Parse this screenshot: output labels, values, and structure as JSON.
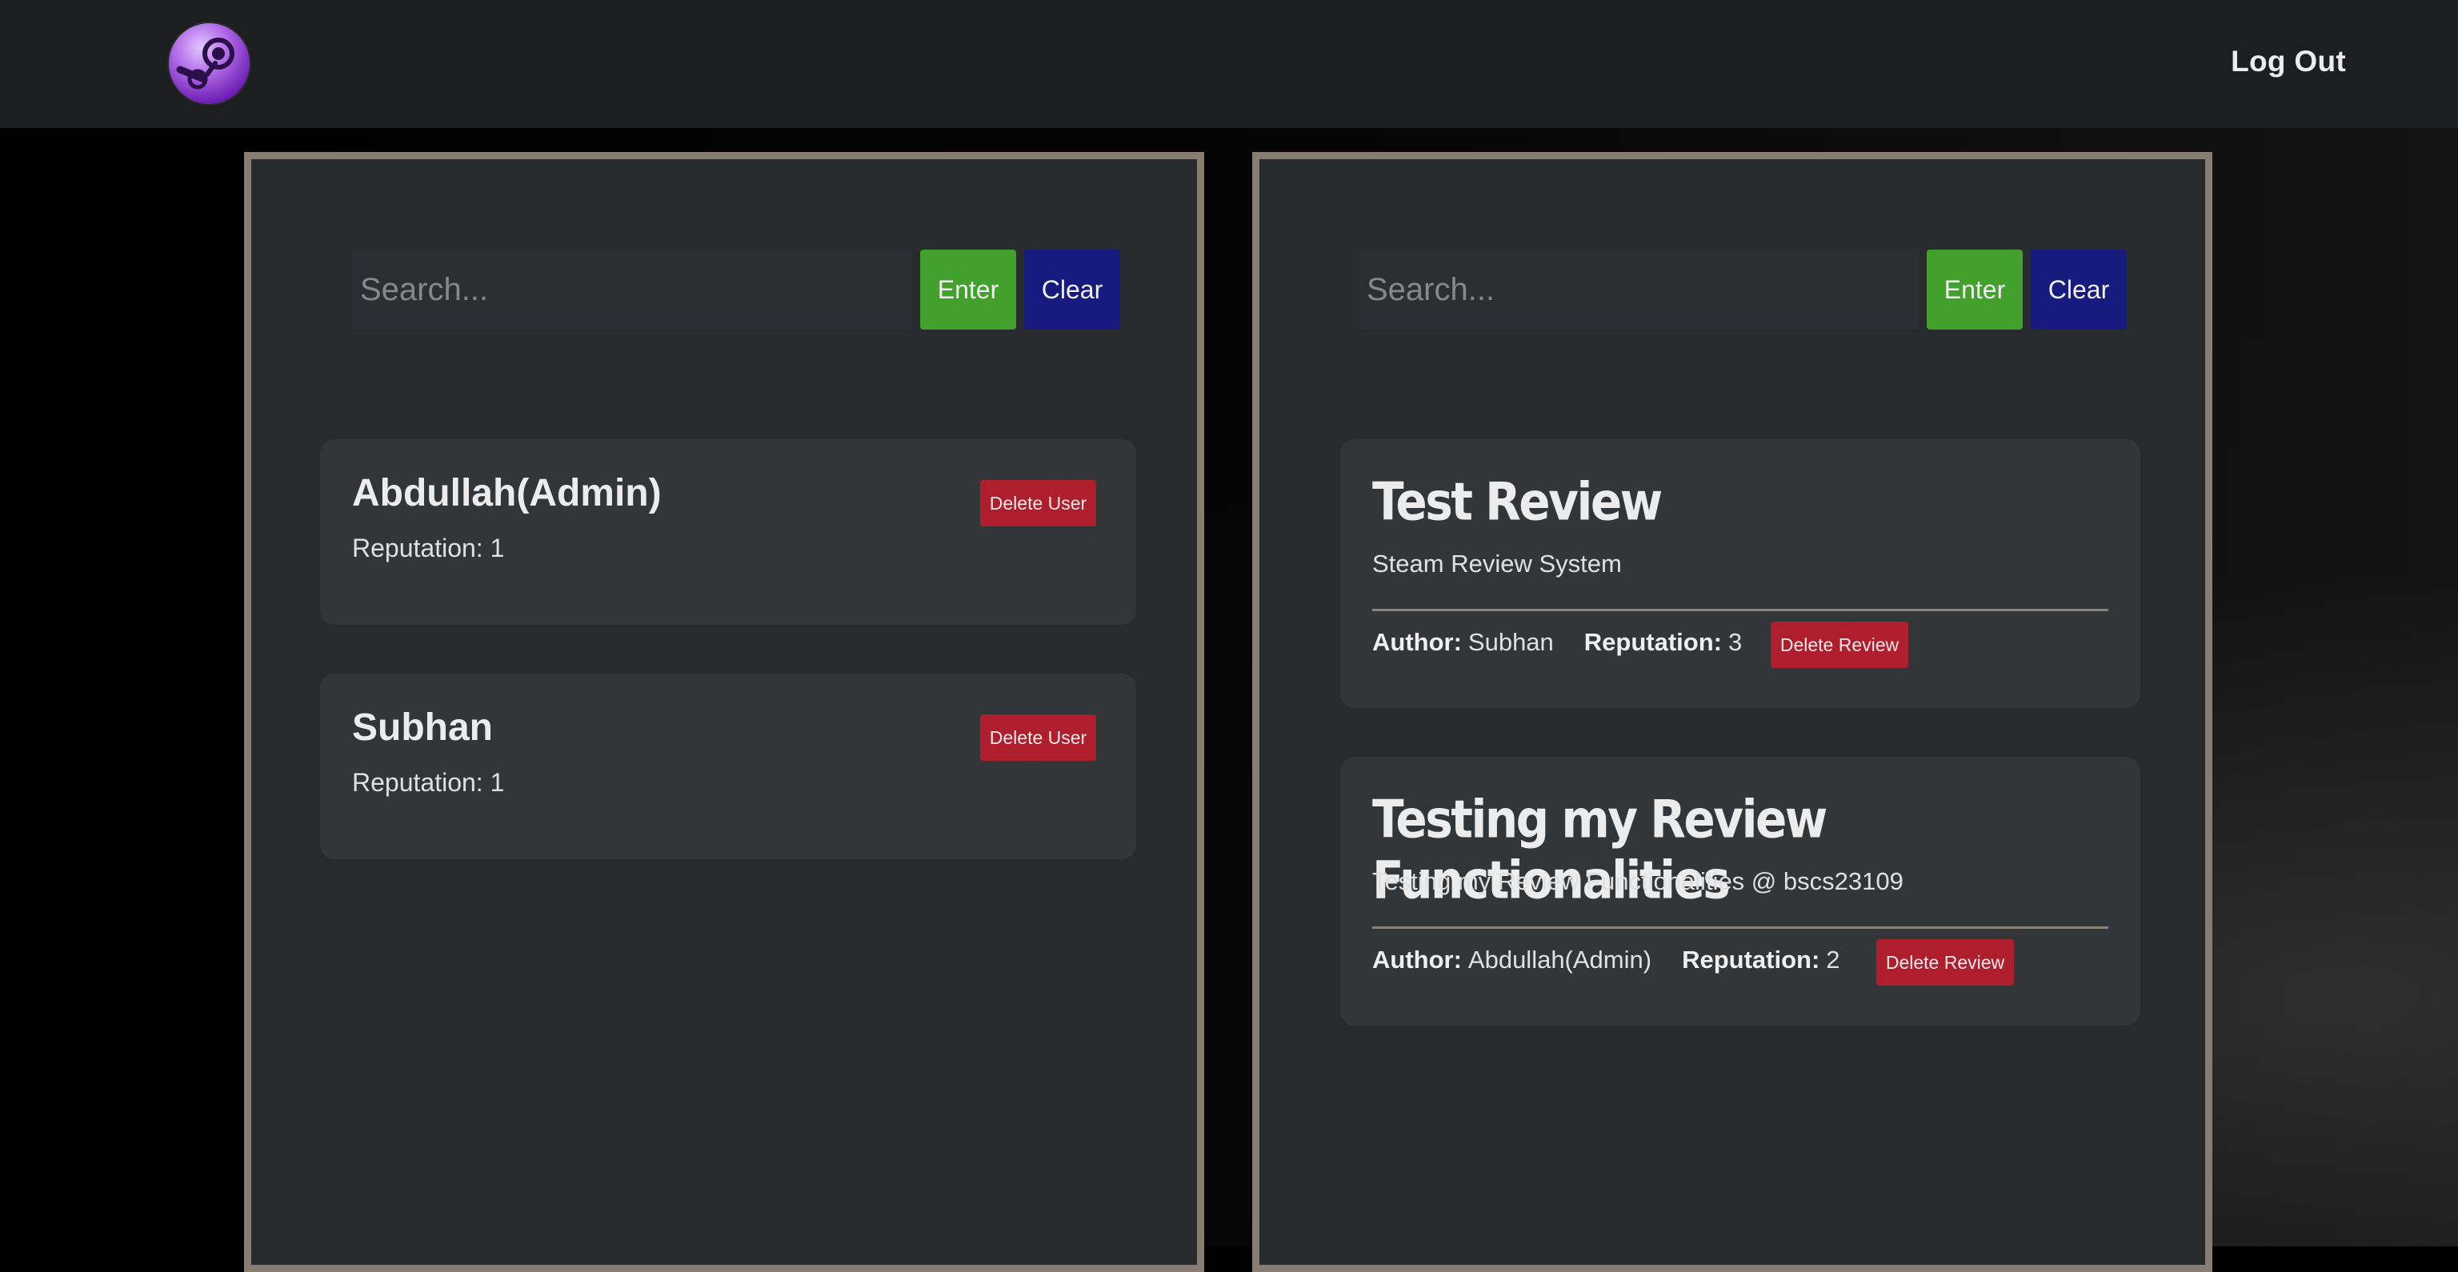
{
  "header": {
    "logo_icon": "steam-logo-icon",
    "logout_label": "Log Out"
  },
  "users_panel": {
    "search": {
      "placeholder": "Search...",
      "value": ""
    },
    "enter_label": "Enter",
    "clear_label": "Clear",
    "users": [
      {
        "name": "Abdullah(Admin)",
        "reputation_label": "Reputation: 1",
        "delete_label": "Delete User"
      },
      {
        "name": "Subhan",
        "reputation_label": "Reputation: 1",
        "delete_label": "Delete User"
      }
    ]
  },
  "reviews_panel": {
    "search": {
      "placeholder": "Search...",
      "value": ""
    },
    "enter_label": "Enter",
    "clear_label": "Clear",
    "reviews": [
      {
        "title": "Test Review",
        "body": "Steam Review System",
        "author_label": "Author:",
        "author": "Subhan",
        "reputation_label": "Reputation:",
        "reputation": "3",
        "delete_label": "Delete Review"
      },
      {
        "title": "Testing my Review Functionalities",
        "body": "Testing my Review Functionalities @ bscs23109",
        "author_label": "Author:",
        "author": "Abdullah(Admin)",
        "reputation_label": "Reputation:",
        "reputation": "2",
        "delete_label": "Delete Review"
      }
    ]
  },
  "colors": {
    "navbar": "#1d1e20",
    "panel": "#282b2d",
    "panel_border": "#877d72",
    "card": "#333639",
    "enter_button": "#42a12c",
    "clear_button": "#171a7f",
    "delete_button": "#ae1e2d"
  }
}
